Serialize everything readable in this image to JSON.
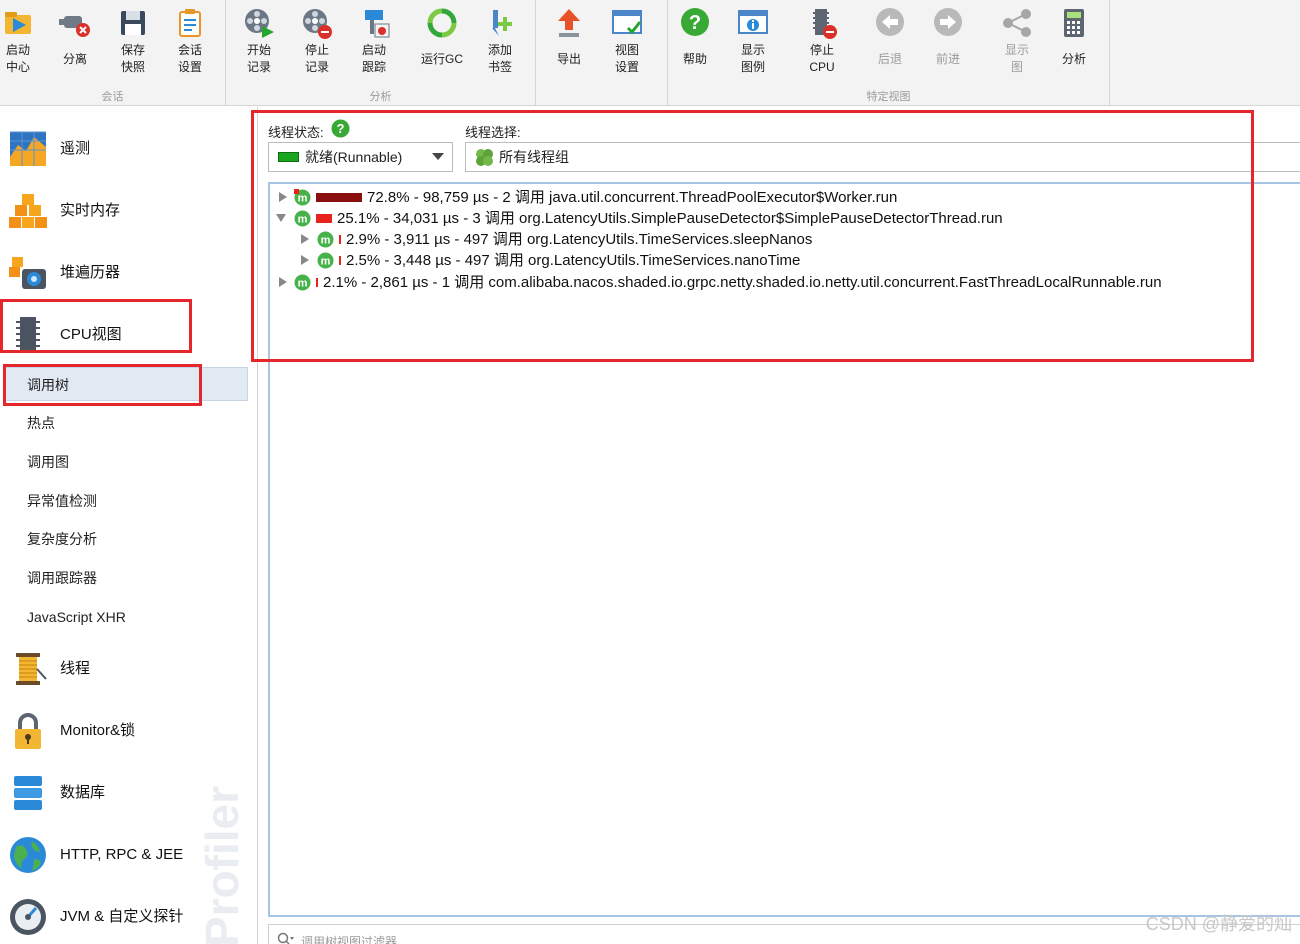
{
  "toolbar": {
    "groups": [
      {
        "label": "会话"
      },
      {
        "label": "分析"
      },
      {
        "label": ""
      },
      {
        "label": "特定视图"
      }
    ],
    "buttons": [
      {
        "label": "启动\n中心"
      },
      {
        "label": "分离"
      },
      {
        "label": "保存\n快照"
      },
      {
        "label": "会话\n设置"
      },
      {
        "label": "开始\n记录"
      },
      {
        "label": "停止\n记录"
      },
      {
        "label": "启动\n跟踪"
      },
      {
        "label": "运行GC"
      },
      {
        "label": "添加\n书签"
      },
      {
        "label": "导出"
      },
      {
        "label": "视图\n设置"
      },
      {
        "label": "帮助"
      },
      {
        "label": "显示\n图例"
      },
      {
        "label": "停止\nCPU"
      },
      {
        "label": "后退"
      },
      {
        "label": "前进"
      },
      {
        "label": "显示\n图"
      },
      {
        "label": "分析"
      }
    ]
  },
  "sidebar": {
    "items": [
      {
        "label": "遥测"
      },
      {
        "label": "实时内存"
      },
      {
        "label": "堆遍历器"
      },
      {
        "label": "CPU视图"
      },
      {
        "label": "线程"
      },
      {
        "label": "Monitor&锁"
      },
      {
        "label": "数据库"
      },
      {
        "label": "HTTP, RPC & JEE"
      },
      {
        "label": "JVM & 自定义探针"
      }
    ],
    "sub_items": [
      {
        "label": "调用树"
      },
      {
        "label": "热点"
      },
      {
        "label": "调用图"
      },
      {
        "label": "异常值检测"
      },
      {
        "label": "复杂度分析"
      },
      {
        "label": "调用跟踪器"
      },
      {
        "label": "JavaScript XHR"
      }
    ],
    "watermark": "Profiler"
  },
  "main": {
    "thread_state_label": "线程状态:",
    "thread_state_value": "就绪(Runnable)",
    "thread_select_label": "线程选择:",
    "thread_select_value": "所有线程组",
    "filter_placeholder": "调用树视图过滤器",
    "tree": [
      {
        "text": "72.8% - 98,759 µs - 2 调用 java.util.concurrent.ThreadPoolExecutor$Worker.run",
        "percent": 72.8,
        "expanded": false
      },
      {
        "text": "25.1% - 34,031 µs - 3 调用 org.LatencyUtils.SimplePauseDetector$SimplePauseDetectorThread.run",
        "percent": 25.1,
        "expanded": true
      },
      {
        "text": "2.9% - 3,911 µs - 497 调用 org.LatencyUtils.TimeServices.sleepNanos",
        "percent": 2.9,
        "expanded": false
      },
      {
        "text": "2.5% - 3,448 µs - 497 调用 org.LatencyUtils.TimeServices.nanoTime",
        "percent": 2.5,
        "expanded": false
      },
      {
        "text": "2.1% - 2,861 µs - 1 调用 com.alibaba.nacos.shaded.io.grpc.netty.shaded.io.netty.util.concurrent.FastThreadLocalRunnable.run",
        "percent": 2.1,
        "expanded": false
      }
    ]
  },
  "credit": "CSDN @静爱的灿",
  "colors": {
    "bar_dark": "#8b0f0f",
    "bar_red": "#e8231b",
    "highlight": "#e5262a",
    "runnable_green": "#1aa520"
  }
}
